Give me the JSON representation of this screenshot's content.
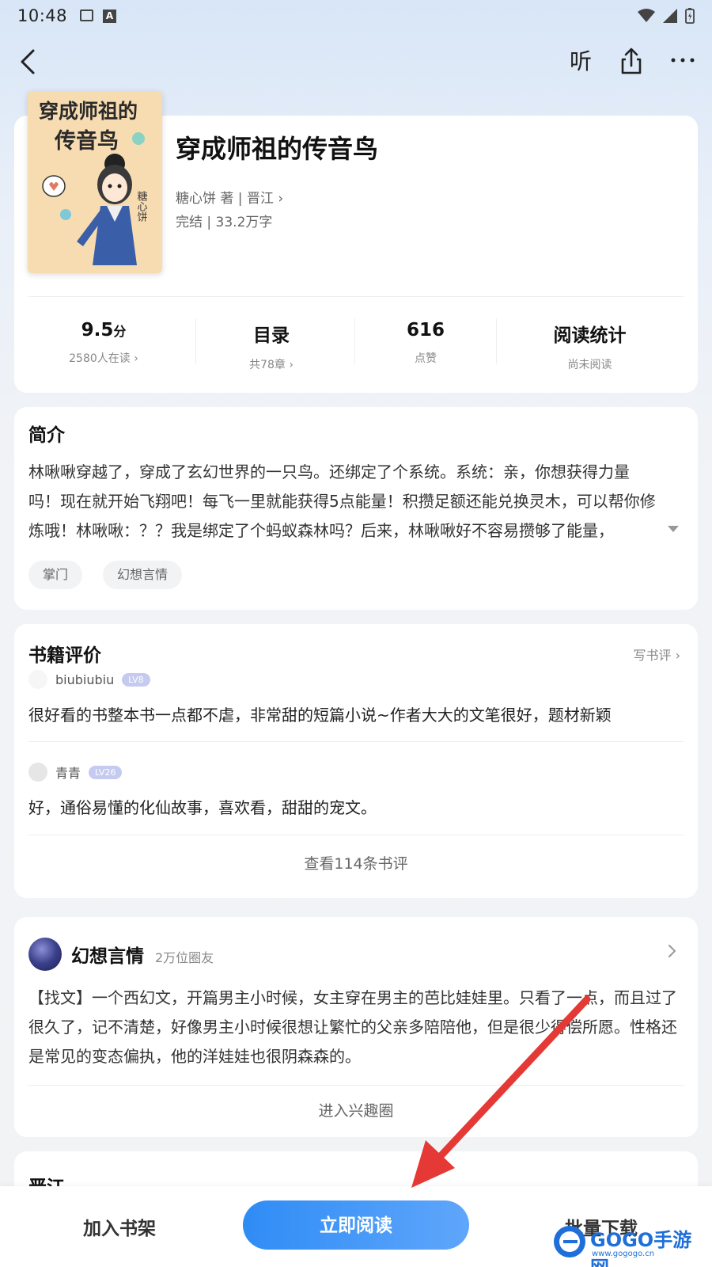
{
  "status_bar": {
    "time": "10:48"
  },
  "topbar": {
    "listen_label": "听"
  },
  "book": {
    "title": "穿成师祖的传音鸟",
    "author_line": "糖心饼 著 | 晋江",
    "meta_line": "完结 | 33.2万字",
    "cover": {
      "title_line1": "穿成师祖的",
      "title_line2": "传音鸟",
      "author_sign": "糖心饼"
    }
  },
  "stats": [
    {
      "value": "9.5",
      "unit": "分",
      "label": "2580人在读"
    },
    {
      "value": "目录",
      "label": "共78章"
    },
    {
      "value": "616",
      "label": "点赞"
    },
    {
      "value": "阅读统计",
      "label": "尚未阅读"
    }
  ],
  "intro": {
    "title": "简介",
    "text": "林啾啾穿越了，穿成了玄幻世界的一只鸟。还绑定了个系统。系统：亲，你想获得力量吗！现在就开始飞翔吧！每飞一里就能获得5点能量！积攒足额还能兑换灵木，可以帮你修炼哦！林啾啾：？？我是绑定了个蚂蚁森林吗？后来，林啾啾好不容易攒够了能量，",
    "tags": [
      "掌门",
      "幻想言情"
    ]
  },
  "reviews": {
    "title": "书籍评价",
    "write_label": "写书评",
    "items": [
      {
        "user": "biubiubiu",
        "level": "LV8",
        "text": "很好看的书整本书一点都不虐，非常甜的短篇小说~作者大大的文笔很好，题材新颖"
      },
      {
        "user": "青青",
        "level": "LV26",
        "text": "好，通俗易懂的化仙故事，喜欢看，甜甜的宠文。"
      }
    ],
    "view_all": "查看114条书评"
  },
  "circle": {
    "name": "幻想言情",
    "members": "2万位圈友",
    "post": "【找文】一个西幻文，开篇男主小时候，女主穿在男主的芭比娃娃里。只看了一点，而且过了很久了，记不清楚，好像男主小时候很想让繁忙的父亲多陪陪他，但是很少得偿所愿。性格还是常见的变态偏执，他的洋娃娃也很阴森森的。",
    "enter_label": "进入兴趣圈"
  },
  "source": {
    "title": "晋江"
  },
  "bottom_bar": {
    "add_shelf": "加入书架",
    "read_now": "立即阅读",
    "batch_download": "批量下载"
  },
  "watermark": {
    "text": "GOGO手游网",
    "url": "www.gogogo.cn"
  },
  "colors": {
    "primary": "#2f8cf5",
    "arrow": "#e53935",
    "level_badge": "#c5cbf0"
  }
}
